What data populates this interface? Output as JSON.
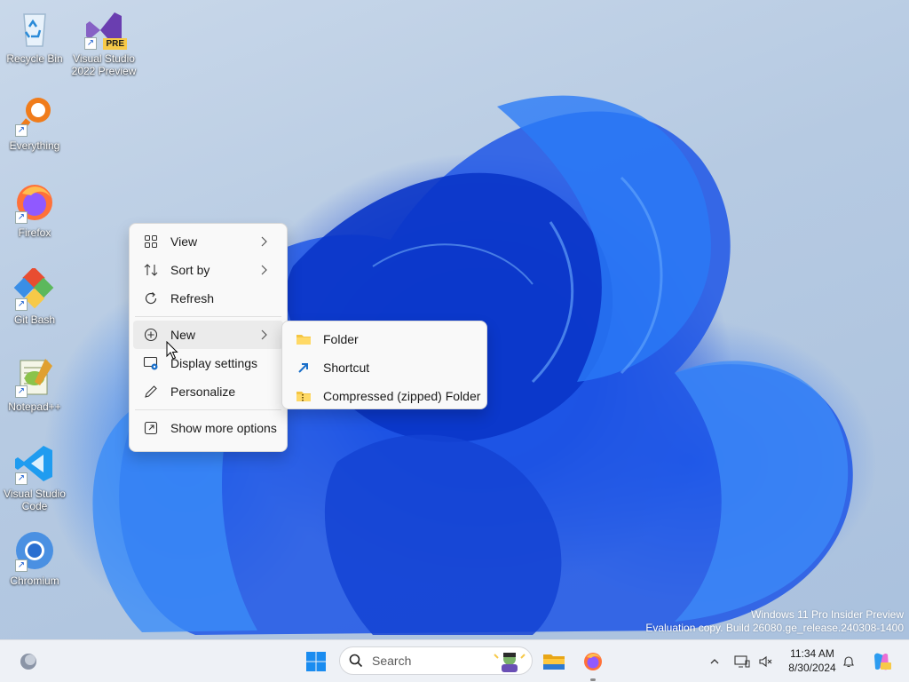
{
  "desktop": {
    "icons": [
      {
        "label": "Recycle Bin",
        "icon": "recycle-bin-icon"
      },
      {
        "label": "Visual Studio 2022 Preview",
        "line1": "Visual Studio",
        "line2": "2022 Preview",
        "badge": "PRE",
        "icon": "visual-studio-icon"
      },
      {
        "label": "Everything",
        "icon": "everything-search-icon"
      },
      {
        "label": "Firefox",
        "icon": "firefox-icon"
      },
      {
        "label": "Git Bash",
        "icon": "git-bash-icon"
      },
      {
        "label": "Notepad++",
        "icon": "notepad-plus-plus-icon"
      },
      {
        "label": "Visual Studio Code",
        "line1": "Visual Studio",
        "line2": "Code",
        "icon": "vscode-icon"
      },
      {
        "label": "Chromium",
        "icon": "chromium-icon"
      }
    ],
    "watermark": {
      "line1": "Windows 11 Pro Insider Preview",
      "line2": "Evaluation copy. Build 26080.ge_release.240308-1400"
    }
  },
  "context_menu": {
    "items": [
      {
        "label": "View",
        "icon": "grid-view-icon",
        "has_submenu": true
      },
      {
        "label": "Sort by",
        "icon": "sort-icon",
        "has_submenu": true
      },
      {
        "label": "Refresh",
        "icon": "refresh-icon",
        "has_submenu": false
      },
      {
        "label": "New",
        "icon": "plus-circle-icon",
        "has_submenu": true
      },
      {
        "label": "Display settings",
        "icon": "display-settings-icon",
        "has_submenu": false
      },
      {
        "label": "Personalize",
        "icon": "pen-icon",
        "has_submenu": false
      },
      {
        "label": "Show more options",
        "icon": "external-icon",
        "has_submenu": false
      }
    ]
  },
  "submenu_new": {
    "items": [
      {
        "label": "Folder",
        "icon": "folder-icon"
      },
      {
        "label": "Shortcut",
        "icon": "shortcut-icon"
      },
      {
        "label": "Compressed (zipped) Folder",
        "icon": "zip-folder-icon"
      }
    ]
  },
  "taskbar": {
    "search_placeholder": "Search",
    "time": "11:34 AM",
    "date": "8/30/2024"
  },
  "colors": {
    "accent": "#0067c0",
    "menu_bg": "#f9f9f9",
    "taskbar_bg": "#eef1f6",
    "folder": "#f4c542"
  }
}
